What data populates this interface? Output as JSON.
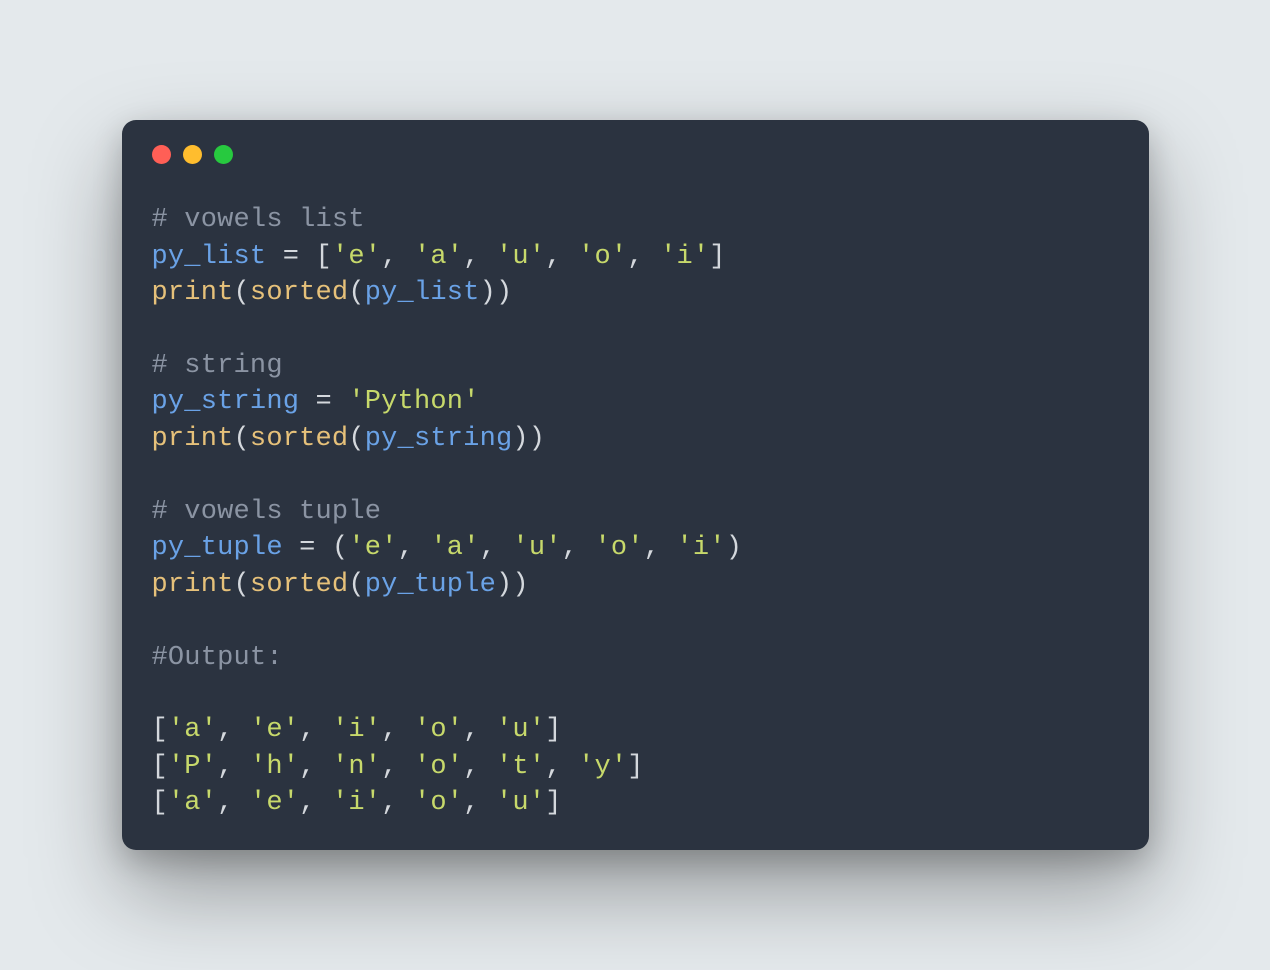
{
  "colors": {
    "bg": "#e4e9ec",
    "window_bg": "#2b3340",
    "dot_red": "#ff5f56",
    "dot_yellow": "#ffbd2e",
    "dot_green": "#27c93f",
    "comment": "#8b94a3",
    "ident": "#6aa2e6",
    "op": "#d4d8dd",
    "string": "#c7d96b",
    "func": "#e6c17a"
  },
  "code": {
    "c1": "# vowels list",
    "l2": {
      "py_list": "py_list",
      "eq": " = ",
      "lb": "[",
      "e": "'e'",
      "comma1": ", ",
      "a": "'a'",
      "comma2": ", ",
      "u": "'u'",
      "comma3": ", ",
      "o": "'o'",
      "comma4": ", ",
      "i": "'i'",
      "rb": "]"
    },
    "l3": {
      "print": "print",
      "lp1": "(",
      "sorted": "sorted",
      "lp2": "(",
      "py_list": "py_list",
      "rp2": ")",
      "rp1": ")"
    },
    "c2": "# string",
    "l5": {
      "py_string": "py_string",
      "eq": " = ",
      "val": "'Python'"
    },
    "l6": {
      "print": "print",
      "lp1": "(",
      "sorted": "sorted",
      "lp2": "(",
      "py_string": "py_string",
      "rp2": ")",
      "rp1": ")"
    },
    "c3": "# vowels tuple",
    "l8": {
      "py_tuple": "py_tuple",
      "eq": " = ",
      "lp": "(",
      "e": "'e'",
      "comma1": ", ",
      "a": "'a'",
      "comma2": ", ",
      "u": "'u'",
      "comma3": ", ",
      "o": "'o'",
      "comma4": ", ",
      "i": "'i'",
      "rp": ")"
    },
    "l9": {
      "print": "print",
      "lp1": "(",
      "sorted": "sorted",
      "lp2": "(",
      "py_tuple": "py_tuple",
      "rp2": ")",
      "rp1": ")"
    },
    "c4": "#Output:",
    "out1": {
      "lb": "[",
      "a": "'a'",
      "c1": ", ",
      "e": "'e'",
      "c2": ", ",
      "i": "'i'",
      "c3": ", ",
      "o": "'o'",
      "c4": ", ",
      "u": "'u'",
      "rb": "]"
    },
    "out2": {
      "lb": "[",
      "P": "'P'",
      "c1": ", ",
      "h": "'h'",
      "c2": ", ",
      "n": "'n'",
      "c3": ", ",
      "o": "'o'",
      "c4": ", ",
      "t": "'t'",
      "c5": ", ",
      "y": "'y'",
      "rb": "]"
    },
    "out3": {
      "lb": "[",
      "a": "'a'",
      "c1": ", ",
      "e": "'e'",
      "c2": ", ",
      "i": "'i'",
      "c3": ", ",
      "o": "'o'",
      "c4": ", ",
      "u": "'u'",
      "rb": "]"
    }
  }
}
